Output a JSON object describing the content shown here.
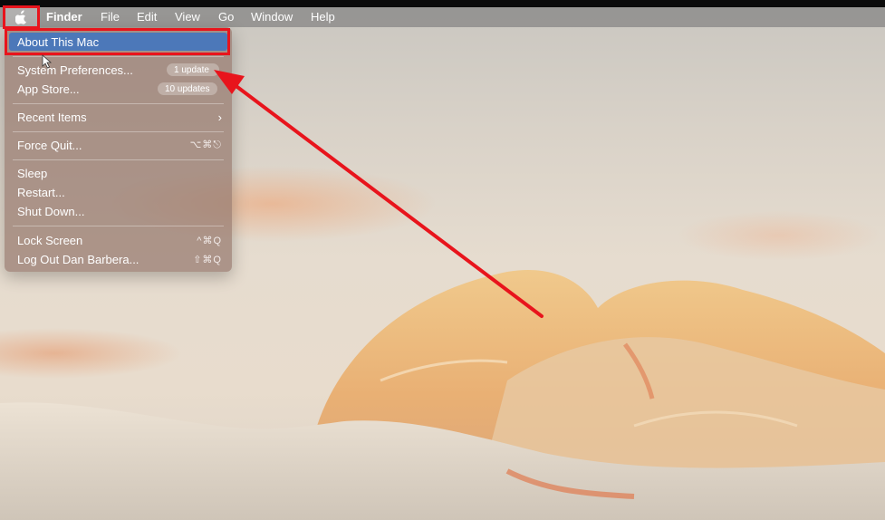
{
  "menubar": {
    "apple_icon": "apple-logo-icon",
    "items": [
      "Finder",
      "File",
      "Edit",
      "View",
      "Go",
      "Window",
      "Help"
    ]
  },
  "apple_menu": {
    "about": "About This Mac",
    "system_preferences": "System Preferences...",
    "system_preferences_badge": "1 update",
    "app_store": "App Store...",
    "app_store_badge": "10 updates",
    "recent_items": "Recent Items",
    "recent_items_chevron": "›",
    "force_quit": "Force Quit...",
    "force_quit_shortcut": "⌥⌘⎋",
    "sleep": "Sleep",
    "restart": "Restart...",
    "shut_down": "Shut Down...",
    "lock_screen": "Lock Screen",
    "lock_screen_shortcut": "^⌘Q",
    "log_out": "Log Out Dan Barbera...",
    "log_out_shortcut": "⇧⌘Q"
  },
  "annotation": {
    "highlight_color": "#e8141c",
    "selected_color": "#4c78b9"
  }
}
